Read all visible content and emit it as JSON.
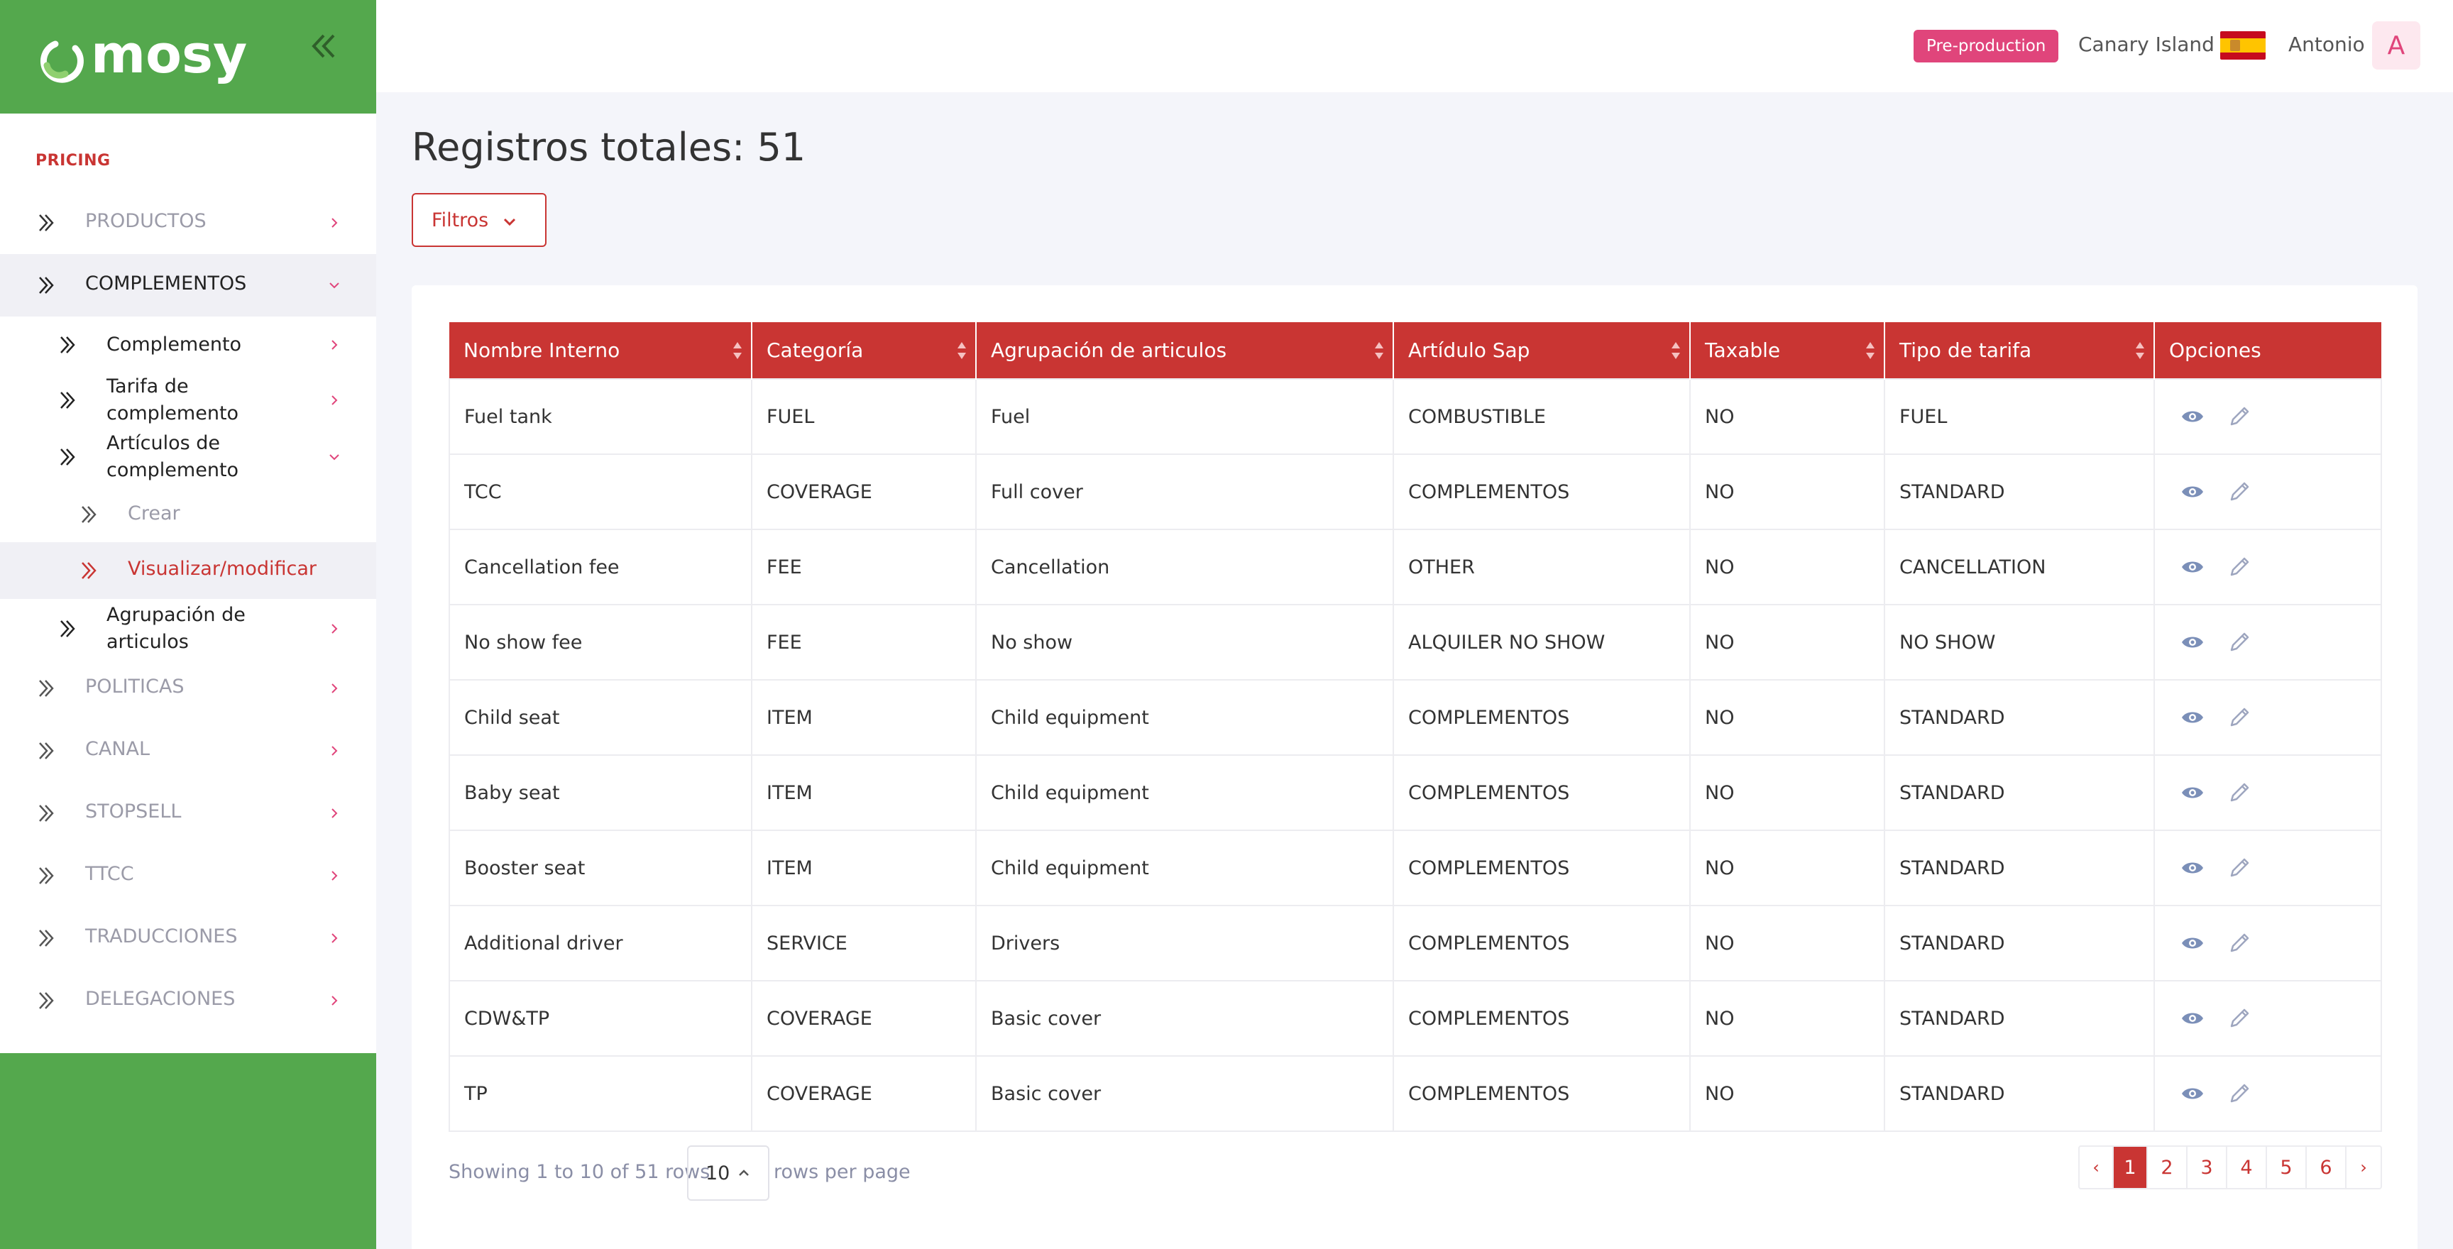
{
  "brand": {
    "logo_text": "mosy",
    "accent": "#c93533",
    "sidebar_green": "#54a84d"
  },
  "header": {
    "env_badge": "Pre-production",
    "region": "Canary Island",
    "flag": "spain-flag",
    "user_name": "Antonio",
    "avatar_initial": "A"
  },
  "sidebar": {
    "section": "PRICING",
    "items": [
      {
        "label": "PRODUCTOS"
      },
      {
        "label": "COMPLEMENTOS"
      },
      {
        "label": "Complemento"
      },
      {
        "label": "Tarifa de complemento"
      },
      {
        "label": "Artículos de complemento"
      },
      {
        "label": "Crear"
      },
      {
        "label": "Visualizar/modificar"
      },
      {
        "label": "Agrupación de articulos"
      },
      {
        "label": "POLITICAS"
      },
      {
        "label": "CANAL"
      },
      {
        "label": "STOPSELL"
      },
      {
        "label": "TTCC"
      },
      {
        "label": "TRADUCCIONES"
      },
      {
        "label": "DELEGACIONES"
      }
    ]
  },
  "main": {
    "title": "Registros totales: 51",
    "filter_label": "Filtros",
    "columns": [
      "Nombre Interno",
      "Categoría",
      "Agrupación de articulos",
      "Artídulo Sap",
      "Taxable",
      "Tipo de tarifa",
      "Opciones"
    ],
    "rows": [
      [
        "Fuel tank",
        "FUEL",
        "Fuel",
        "COMBUSTIBLE",
        "NO",
        "FUEL"
      ],
      [
        "TCC",
        "COVERAGE",
        "Full cover",
        "COMPLEMENTOS",
        "NO",
        "STANDARD"
      ],
      [
        "Cancellation fee",
        "FEE",
        "Cancellation",
        "OTHER",
        "NO",
        "CANCELLATION"
      ],
      [
        "No show fee",
        "FEE",
        "No show",
        "ALQUILER NO SHOW",
        "NO",
        "NO SHOW"
      ],
      [
        "Child seat",
        "ITEM",
        "Child equipment",
        "COMPLEMENTOS",
        "NO",
        "STANDARD"
      ],
      [
        "Baby seat",
        "ITEM",
        "Child equipment",
        "COMPLEMENTOS",
        "NO",
        "STANDARD"
      ],
      [
        "Booster seat",
        "ITEM",
        "Child equipment",
        "COMPLEMENTOS",
        "NO",
        "STANDARD"
      ],
      [
        "Additional driver",
        "SERVICE",
        "Drivers",
        "COMPLEMENTOS",
        "NO",
        "STANDARD"
      ],
      [
        "CDW&TP",
        "COVERAGE",
        "Basic cover",
        "COMPLEMENTOS",
        "NO",
        "STANDARD"
      ],
      [
        "TP",
        "COVERAGE",
        "Basic cover",
        "COMPLEMENTOS",
        "NO",
        "STANDARD"
      ]
    ],
    "footer": {
      "showing": "Showing 1 to 10 of 51 rows",
      "page_size": "10",
      "rows_per_page": "rows per page",
      "prev": "‹",
      "next": "›",
      "pages": [
        "1",
        "2",
        "3",
        "4",
        "5",
        "6"
      ],
      "current_page": "1"
    }
  }
}
